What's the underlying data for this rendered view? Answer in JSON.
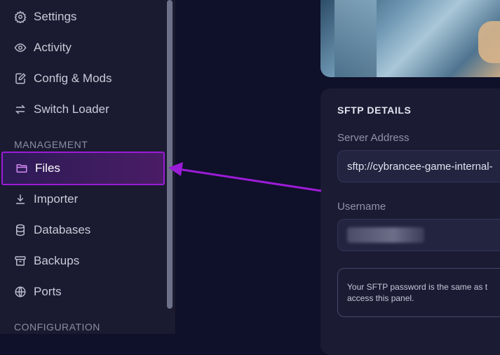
{
  "sidebar": {
    "items_top": [
      {
        "label": "Settings",
        "icon": "gear-icon"
      },
      {
        "label": "Activity",
        "icon": "eye-icon"
      },
      {
        "label": "Config & Mods",
        "icon": "file-edit-icon"
      },
      {
        "label": "Switch Loader",
        "icon": "swap-icon"
      }
    ],
    "section_management": "MANAGEMENT",
    "items_management": [
      {
        "label": "Files",
        "icon": "folder-icon",
        "active": true
      },
      {
        "label": "Importer",
        "icon": "download-icon"
      },
      {
        "label": "Databases",
        "icon": "database-icon"
      },
      {
        "label": "Backups",
        "icon": "archive-icon"
      },
      {
        "label": "Ports",
        "icon": "globe-icon"
      }
    ],
    "section_configuration": "CONFIGURATION"
  },
  "sftp": {
    "title": "SFTP DETAILS",
    "server_address_label": "Server Address",
    "server_address_value": "sftp://cybrancee-game-internal-",
    "username_label": "Username",
    "note": "Your SFTP password is the same as t access this panel."
  },
  "colors": {
    "accent": "#9b1cd6",
    "sidebar_bg": "#1a1b30",
    "page_bg": "#0f1029"
  }
}
